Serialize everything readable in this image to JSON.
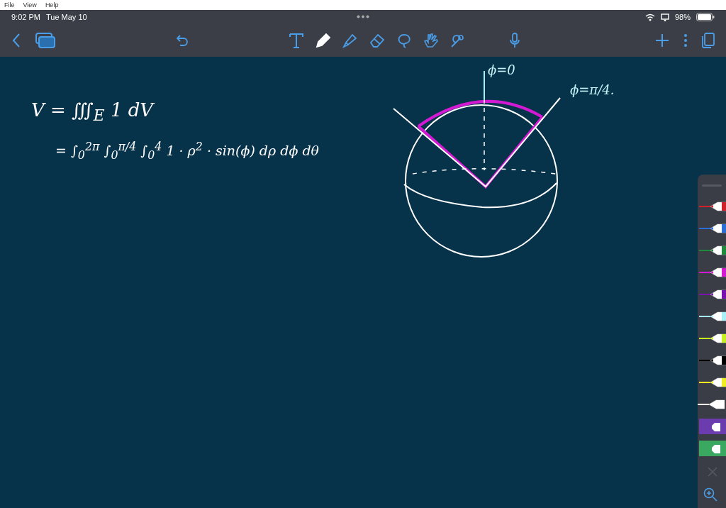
{
  "menu_bar": [
    "File",
    "View",
    "Help"
  ],
  "status_bar": {
    "time": "9:02 PM",
    "date": "Tue May 10",
    "battery": "98%"
  },
  "toolbar": {
    "tools": [
      {
        "kind": "text",
        "selected": false
      },
      {
        "kind": "pen",
        "selected": true
      },
      {
        "kind": "highlighter",
        "selected": false
      },
      {
        "kind": "eraser",
        "selected": false
      },
      {
        "kind": "lasso",
        "selected": false
      },
      {
        "kind": "hand",
        "selected": false
      },
      {
        "kind": "laser",
        "selected": false
      }
    ]
  },
  "canvas": {
    "lines": [
      "V = ∭$_{E}$ 1 dV",
      "= ∫$_{0}$$^{2π}$ ∫$_{0}$$^{π/4}$ ∫$_{0}$$^{4}$ 1 · ρ$^{2}$ · sin(ϕ) dρ dϕ dθ"
    ],
    "labels": [
      "ϕ=0",
      "ϕ=π/4."
    ]
  },
  "pens": [
    {
      "kind": "pen",
      "color": "#d0202a",
      "selected": false
    },
    {
      "kind": "pen",
      "color": "#2a6fd6",
      "selected": false
    },
    {
      "kind": "pen",
      "color": "#1f8a3a",
      "selected": false
    },
    {
      "kind": "pen",
      "color": "#d21ad2",
      "selected": false
    },
    {
      "kind": "pen",
      "color": "#7a12b0",
      "selected": false
    },
    {
      "kind": "pen",
      "color": "#a8f0f8",
      "selected": false
    },
    {
      "kind": "pen",
      "color": "#c8f020",
      "selected": false
    },
    {
      "kind": "pen",
      "color": "#000000",
      "selected": false
    },
    {
      "kind": "pen",
      "color": "#f0f020",
      "selected": false
    },
    {
      "kind": "pen",
      "color": "#ffffff",
      "selected": true
    },
    {
      "kind": "highlighter",
      "color": "#6a3cae",
      "selected": false
    },
    {
      "kind": "highlighter",
      "color": "#3aa860",
      "selected": false
    }
  ]
}
